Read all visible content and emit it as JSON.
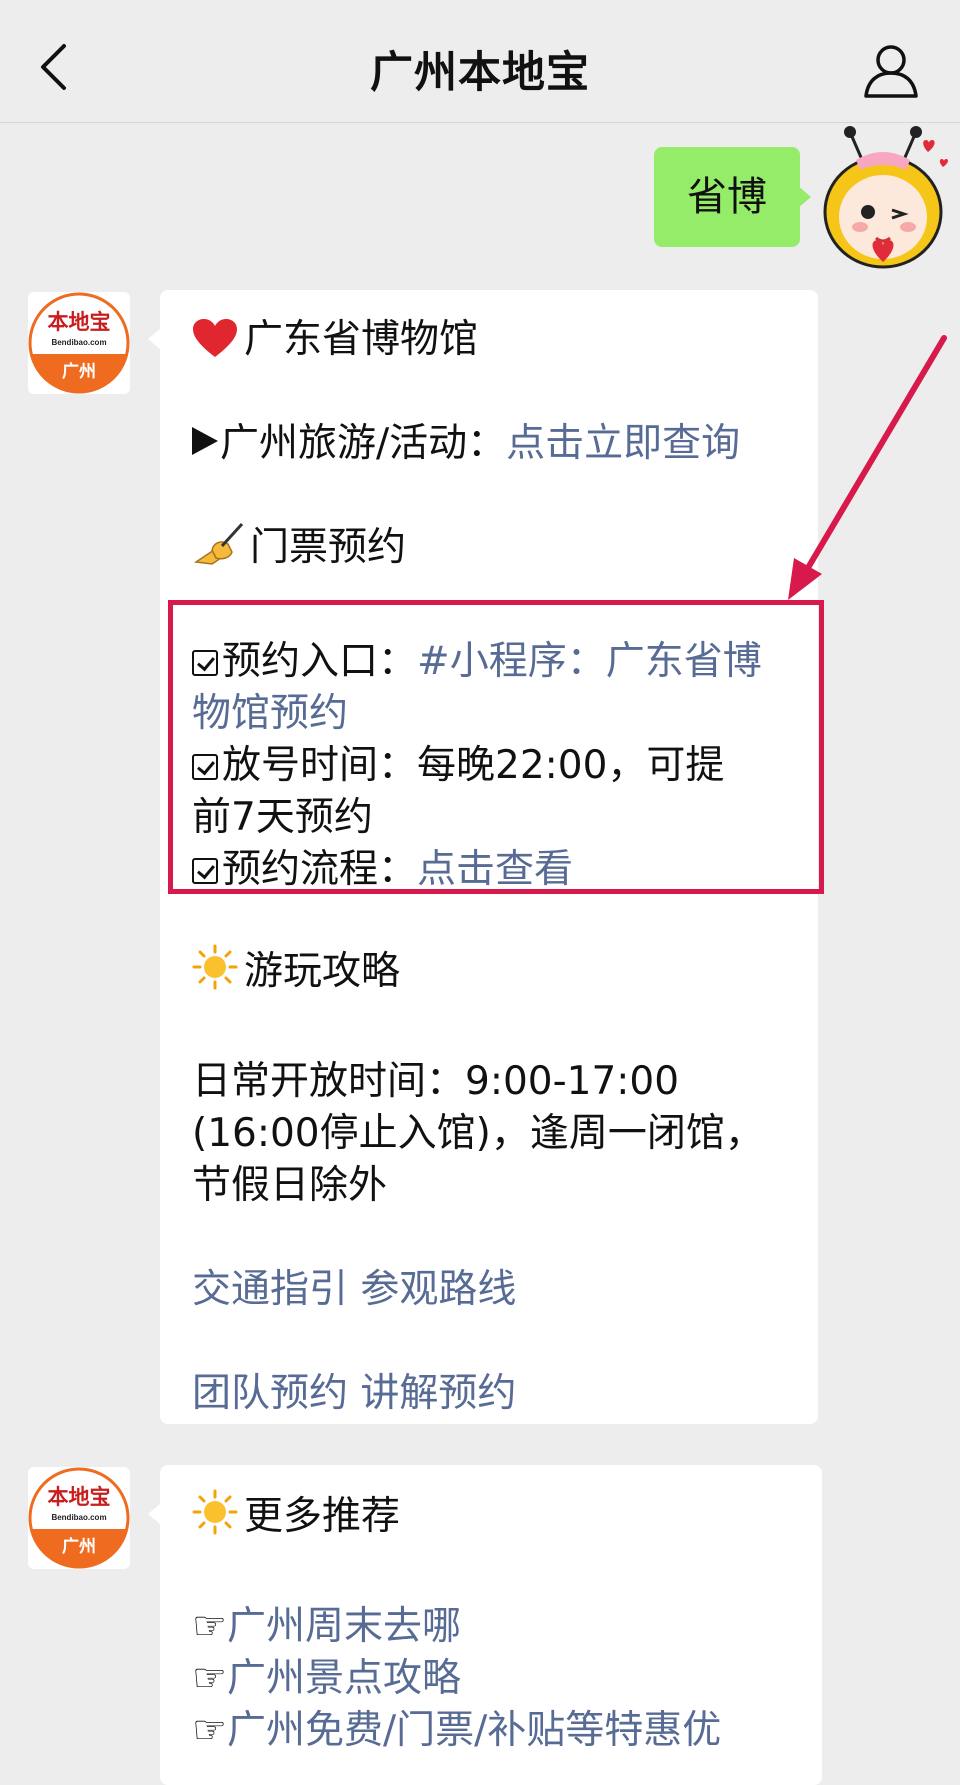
{
  "header": {
    "title": "广州本地宝"
  },
  "messages": {
    "outgoing": {
      "text": "省博"
    },
    "reply1": {
      "title": "广东省博物馆",
      "travel_label": "广州旅游/活动：",
      "travel_link": "点击立即查询",
      "ticket_heading": "门票预约",
      "entry_label": "预约入口：",
      "entry_link_line1": "#小程序：广东省博",
      "entry_link_line2": "物馆预约",
      "release_line1": "放号时间：每晚22:00，可提",
      "release_line2": "前7天预约",
      "flow_label": "预约流程：",
      "flow_link": "点击查看",
      "guide_heading": "游玩攻略",
      "hours_line1": "日常开放时间：9:00-17:00",
      "hours_line2": "(16:00停止入馆)，逢周一闭馆，",
      "hours_line3": "节假日除外",
      "link_traffic": "交通指引",
      "link_route": "参观路线",
      "link_group": "团队预约",
      "link_guide": "讲解预约"
    },
    "reply2": {
      "heading": "更多推荐",
      "links": [
        "广州周末去哪",
        "广州景点攻略",
        "广州免费/门票/补贴等特惠优"
      ]
    }
  },
  "avatar": {
    "brand": "本地宝",
    "domain": "Bendibao.com",
    "city": "广州"
  },
  "colors": {
    "link": "#576b95",
    "bubble_out": "#95ec69",
    "highlight": "#d71a4b",
    "avatar_orange": "#ef6b1f"
  },
  "icons": [
    "back-icon",
    "profile-icon",
    "heart-icon",
    "play-icon",
    "writing-hand-icon",
    "checkbox-icon",
    "sun-icon",
    "pointing-hand-icon"
  ]
}
